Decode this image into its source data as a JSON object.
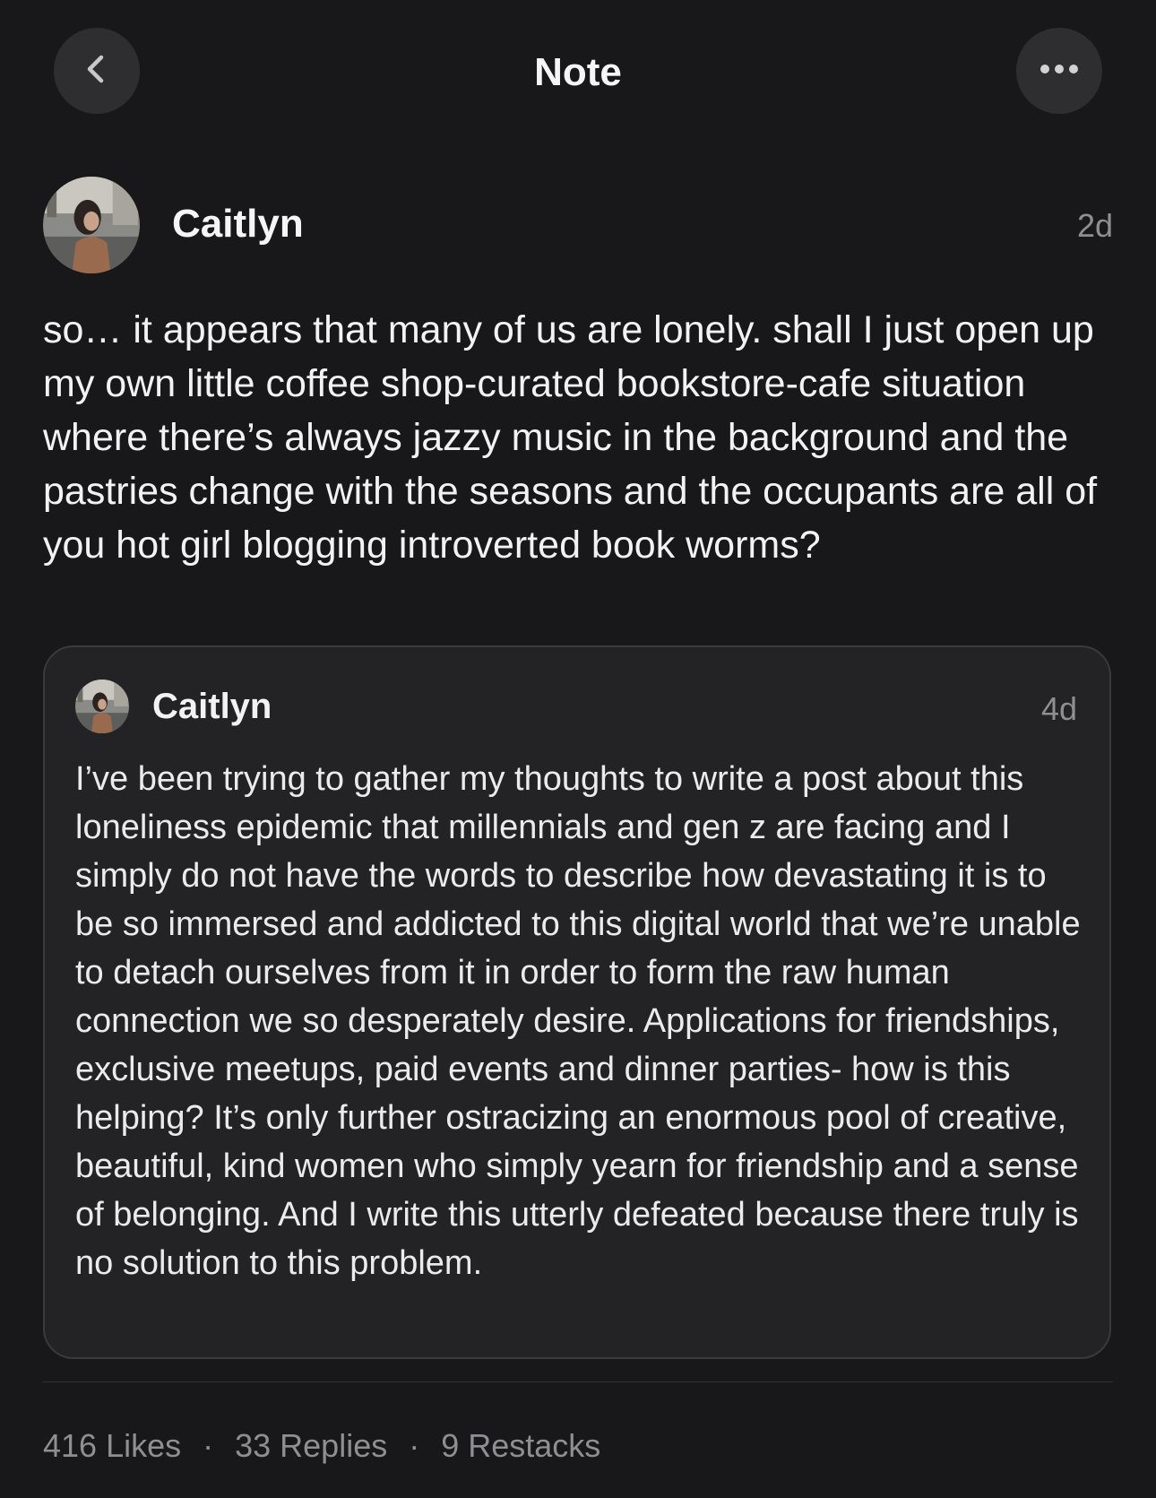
{
  "header": {
    "title": "Note",
    "back_icon": "chevron-left-icon",
    "more_icon": "ellipsis-icon"
  },
  "note": {
    "author": "Caitlyn",
    "time": "2d",
    "body": "so… it appears that many of us are lonely. shall I just open up my own little coffee shop-curated bookstore-cafe situation where there’s always jazzy music in the background and the pastries change with the seasons and the occupants are all of you hot girl blogging introverted book worms?"
  },
  "quoted_note": {
    "author": "Caitlyn",
    "time": "4d",
    "body": "I’ve been trying to gather my thoughts to write a post about this loneliness epidemic that millennials and gen z are facing and I simply do not have the words to describe how devastating it is to be so immersed and addicted to this digital world that we’re unable to detach ourselves from it in order to form the raw human connection we so desperately desire. Applications for friendships, exclusive meetups, paid events and dinner parties- how is this helping? It’s only further ostracizing an enormous pool of creative, beautiful, kind women who simply yearn for friendship and a sense of belonging. And I write this utterly defeated because there truly is no solution to this problem."
  },
  "stats": {
    "likes": "416 Likes",
    "replies": "33 Replies",
    "restacks": "9 Restacks",
    "separator": "·"
  },
  "colors": {
    "background": "#18181a",
    "card": "#232325",
    "muted": "#8e8e93"
  }
}
